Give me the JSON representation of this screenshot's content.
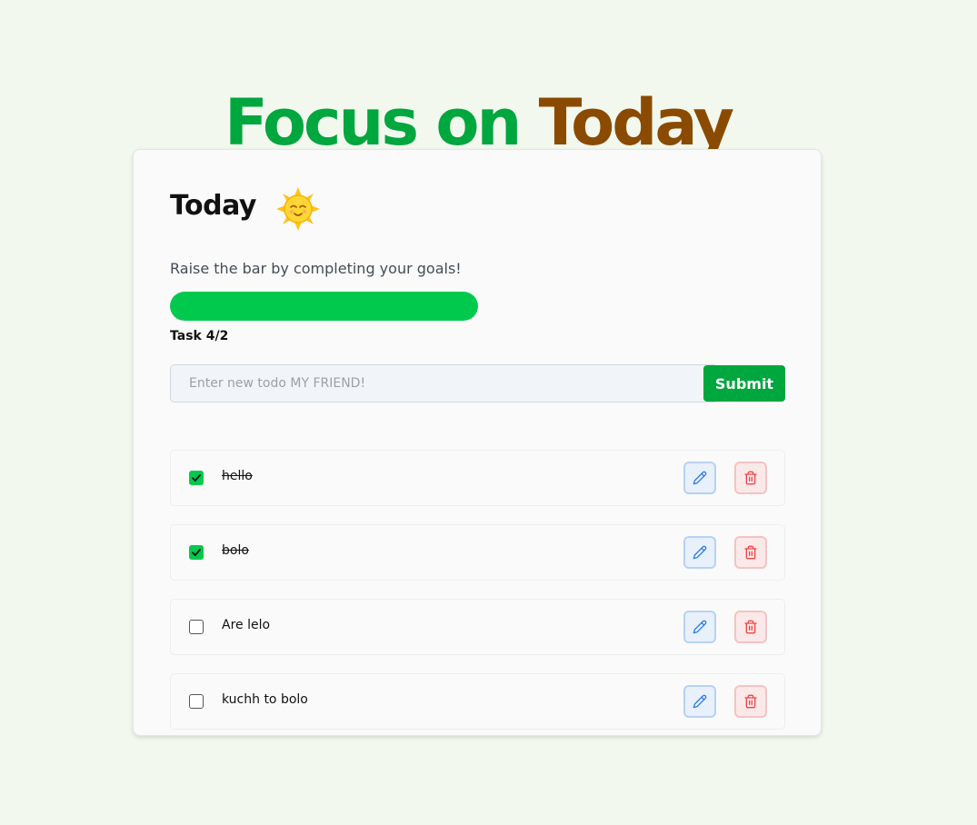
{
  "header": {
    "title_part1": "Focus on",
    "title_part2": "Today"
  },
  "card": {
    "heading": "Today",
    "heading_icon": "sun-icon",
    "subtitle": "Raise the bar by completing your goals!",
    "progress_fraction": 1.0,
    "task_count": "Task 4/2"
  },
  "form": {
    "placeholder": "Enter new todo MY FRIEND!",
    "value": "",
    "submit_label": "Submit"
  },
  "todos": [
    {
      "text": "hello",
      "completed": true
    },
    {
      "text": "bolo",
      "completed": true
    },
    {
      "text": "Are lelo",
      "completed": false
    },
    {
      "text": "kuchh to bolo",
      "completed": false
    }
  ],
  "item_actions": {
    "edit_icon": "pencil-icon",
    "delete_icon": "trash-icon"
  },
  "colors": {
    "accent_green": "#00a63e",
    "accent_green_bright": "#00c94e",
    "accent_brown": "#8a4b00",
    "background": "#f2f8ee"
  }
}
